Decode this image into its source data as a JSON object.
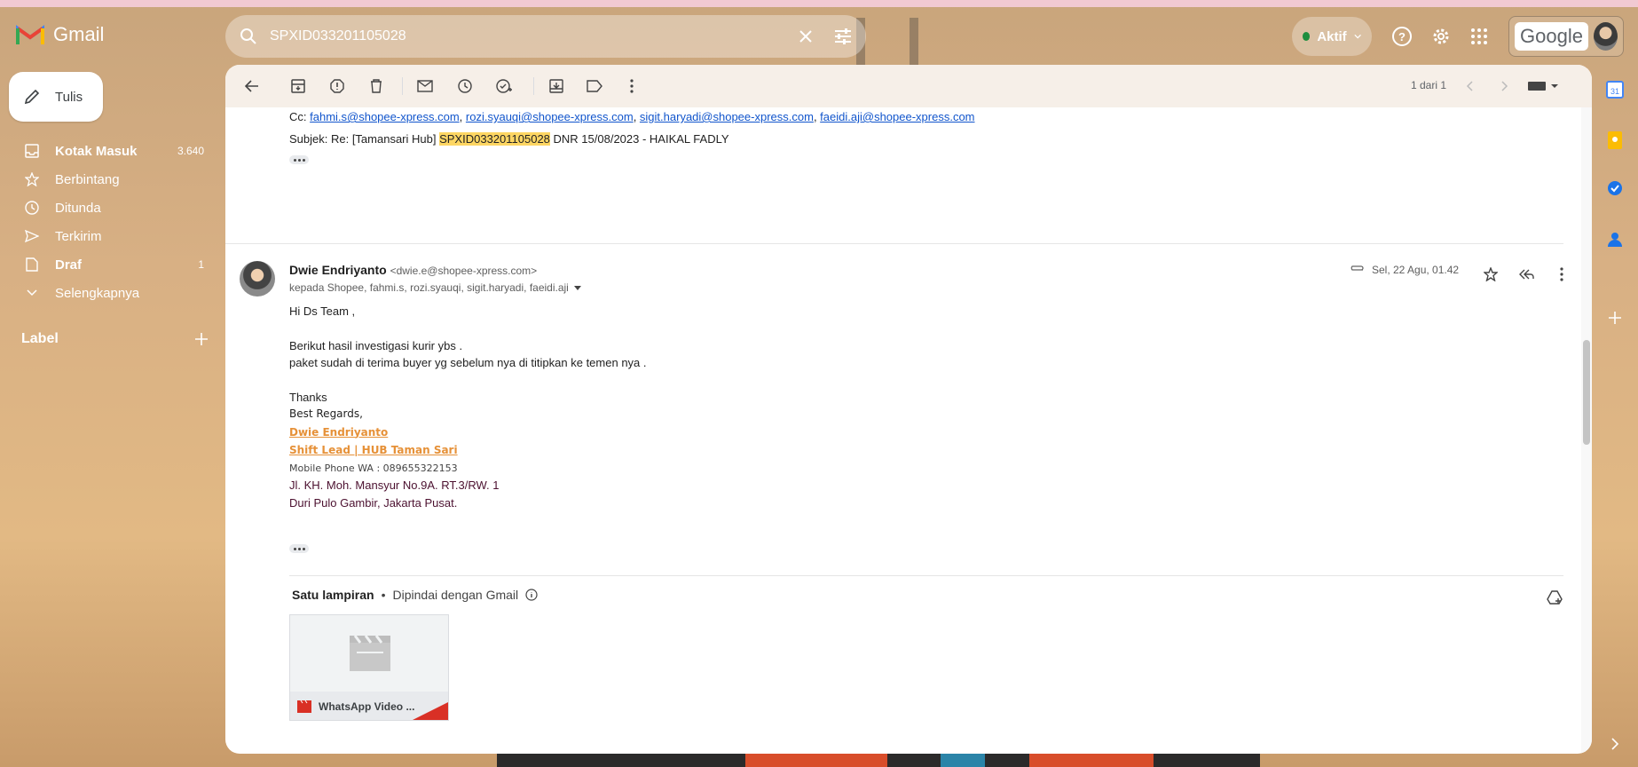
{
  "app": {
    "name": "Gmail"
  },
  "search": {
    "query": "SPXID033201105028"
  },
  "status": {
    "label": "Aktif",
    "color": "#1e8e3e"
  },
  "account": {
    "brand": "Google"
  },
  "compose": {
    "label": "Tulis"
  },
  "sidebar": {
    "items": [
      {
        "label": "Kotak Masuk",
        "count": "3.640",
        "icon": "inbox-icon",
        "bold": true
      },
      {
        "label": "Berbintang",
        "count": "",
        "icon": "star-icon",
        "bold": false
      },
      {
        "label": "Ditunda",
        "count": "",
        "icon": "clock-icon",
        "bold": false
      },
      {
        "label": "Terkirim",
        "count": "",
        "icon": "send-icon",
        "bold": false
      },
      {
        "label": "Draf",
        "count": "1",
        "icon": "draft-icon",
        "bold": true
      },
      {
        "label": "Selengkapnya",
        "count": "",
        "icon": "chevron-down-icon",
        "bold": false
      }
    ],
    "labels_header": "Label"
  },
  "toolbar": {
    "pager": "1 dari 1"
  },
  "previous_message": {
    "cc_prefix": "Cc:",
    "cc": [
      "fahmi.s@shopee-xpress.com",
      "rozi.syauqi@shopee-xpress.com",
      "sigit.haryadi@shopee-xpress.com",
      "faeidi.aji@shopee-xpress.com"
    ],
    "subject_prefix": "Subjek: Re: [Tamansari Hub]",
    "subject_highlight": "SPXID033201105028",
    "subject_suffix": "DNR 15/08/2023 - HAIKAL FADLY"
  },
  "message": {
    "sender_name": "Dwie Endriyanto",
    "sender_email": "<dwie.e@shopee-xpress.com>",
    "recipients": "kepada Shopee, fahmi.s, rozi.syauqi, sigit.haryadi, faeidi.aji",
    "date": "Sel, 22 Agu, 01.42",
    "greeting": "Hi Ds Team ,",
    "line1": "Berikut hasil investigasi kurir ybs .",
    "line2": "paket sudah di terima buyer yg sebelum nya di titipkan ke temen nya .",
    "thanks": "Thanks",
    "regards": "Best Regards,",
    "sig_name": "Dwie Endriyanto",
    "sig_title": "Shift Lead | HUB Taman Sari",
    "sig_phone": "Mobile Phone WA : 089655322153",
    "sig_addr1": "Jl. KH. Moh. Mansyur No.9A. RT.3/RW. 1",
    "sig_addr2": "Duri Pulo Gambir, Jakarta Pusat."
  },
  "attachments": {
    "header": "Satu lampiran",
    "scan_note": "Dipindai dengan Gmail",
    "file_name": "WhatsApp Video ..."
  }
}
